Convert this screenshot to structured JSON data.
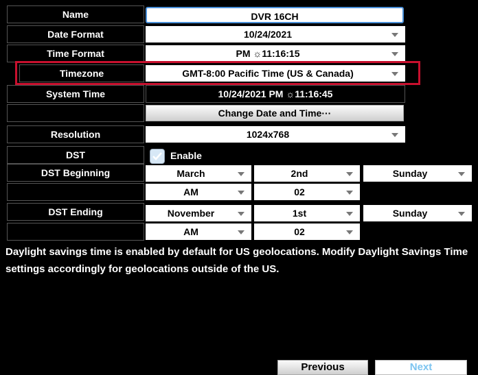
{
  "form": {
    "name": {
      "label": "Name",
      "value": "DVR 16CH"
    },
    "date_format": {
      "label": "Date Format",
      "value": "10/24/2021"
    },
    "time_format": {
      "label": "Time Format",
      "value": "PM ☼11:16:15"
    },
    "timezone": {
      "label": "Timezone",
      "value": "GMT-8:00 Pacific Time (US & Canada)"
    },
    "system_time": {
      "label": "System Time",
      "value": "10/24/2021 PM ☼11:16:45"
    },
    "change_button": "Change Date and Time···",
    "resolution": {
      "label": "Resolution",
      "value": "1024x768"
    },
    "dst": {
      "label": "DST",
      "enable_label": "Enable",
      "checked": true
    },
    "dst_beginning": {
      "label": "DST Beginning",
      "month": "March",
      "week": "2nd",
      "day": "Sunday",
      "ampm": "AM",
      "hour": "02"
    },
    "dst_ending": {
      "label": "DST Ending",
      "month": "November",
      "week": "1st",
      "day": "Sunday",
      "ampm": "AM",
      "hour": "02"
    }
  },
  "note": "Daylight savings time is enabled by default for US geolocations. Modify Daylight Savings Time settings accordingly for geolocations outside of the US.",
  "buttons": {
    "previous": "Previous",
    "next": "Next"
  },
  "colors": {
    "highlight": "#c8102e",
    "next_text": "#7cc4f0"
  }
}
